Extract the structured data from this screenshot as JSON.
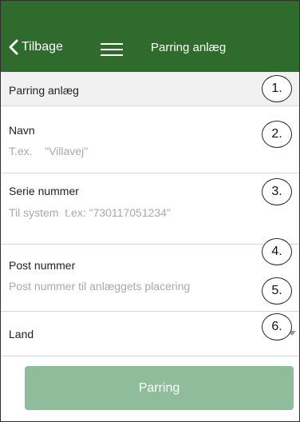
{
  "header": {
    "back_label": "Tilbage",
    "title": "Parring anlæg",
    "bg_color": "#2e6b2c"
  },
  "section": {
    "title": "Parring anlæg"
  },
  "form": {
    "navn": {
      "label": "Navn",
      "placeholder": "T.ex.    \"Villavej\"",
      "value": ""
    },
    "serie": {
      "label": "Serie nummer",
      "placeholder": "Til system  t.ex: \"730117051234\"",
      "value": ""
    },
    "post": {
      "label": "Post nummer",
      "placeholder": "Post nummer til anlæggets placering",
      "value": ""
    },
    "land": {
      "label": "Land",
      "selected": ""
    }
  },
  "annotations": [
    "1.",
    "2.",
    "3.",
    "4.",
    "5.",
    "6."
  ],
  "submit": {
    "label": "Parring",
    "color": "#8fbd9b"
  },
  "icons": {
    "back": "chevron-left-icon",
    "menu": "hamburger-menu-icon",
    "dropdown": "caret-down-icon"
  }
}
